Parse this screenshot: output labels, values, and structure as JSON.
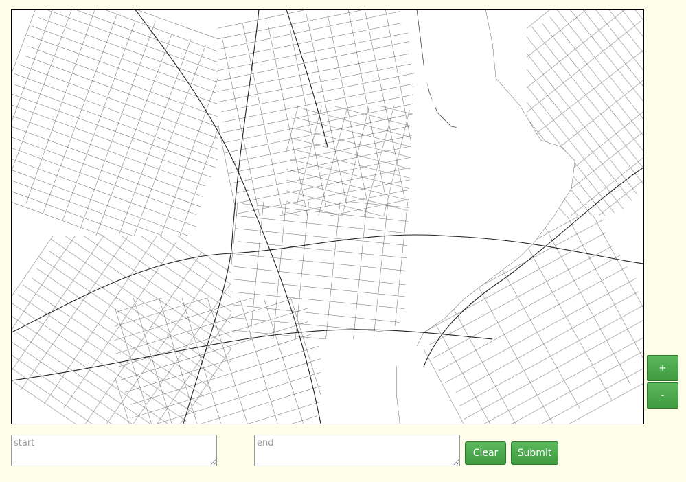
{
  "map": {
    "name": "street-map",
    "background": "#ffffff",
    "line_color": "#333333"
  },
  "zoom": {
    "in_label": "+",
    "out_label": "-"
  },
  "route": {
    "start_placeholder": "start",
    "start_value": "",
    "end_placeholder": "end",
    "end_value": ""
  },
  "actions": {
    "clear_label": "Clear",
    "submit_label": "Submit"
  },
  "colors": {
    "page_background": "#fefde9",
    "button_green": "#4cae4c",
    "button_text": "#ffffff"
  }
}
